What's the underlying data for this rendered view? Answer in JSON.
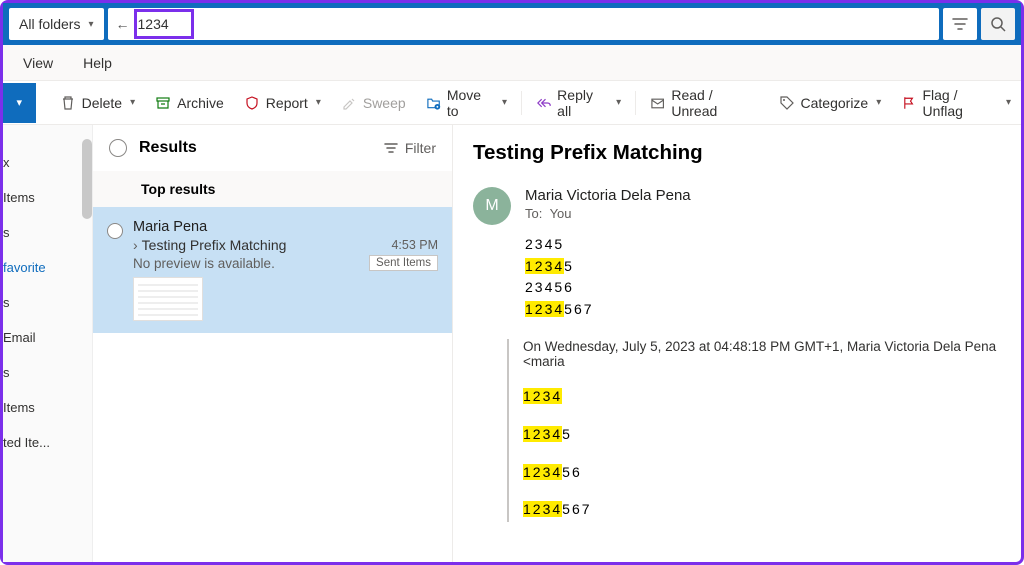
{
  "search": {
    "folder_label": "All folders",
    "query": "1234"
  },
  "menu": {
    "view": "View",
    "help": "Help"
  },
  "toolbar": {
    "delete": "Delete",
    "archive": "Archive",
    "report": "Report",
    "sweep": "Sweep",
    "moveto": "Move to",
    "replyall": "Reply all",
    "readunread": "Read / Unread",
    "categorize": "Categorize",
    "flag": "Flag / Unflag"
  },
  "sidebar": {
    "items": [
      "x",
      "Items",
      "s",
      "favorite",
      "s",
      "Email",
      "s",
      "Items",
      "ted Ite..."
    ]
  },
  "results": {
    "title": "Results",
    "filter": "Filter",
    "top_label": "Top results",
    "item": {
      "from": "Maria Pena",
      "subject": "Testing Prefix Matching",
      "preview": "No preview is available.",
      "time": "4:53 PM",
      "folder": "Sent Items"
    }
  },
  "reading": {
    "subject": "Testing Prefix Matching",
    "avatar_initial": "M",
    "sender": "Maria Victoria Dela Pena",
    "to_label": "To:",
    "to_value": "You",
    "body_lines": [
      {
        "segments": [
          {
            "t": "2345",
            "hl": false
          }
        ]
      },
      {
        "segments": [
          {
            "t": "1234",
            "hl": true
          },
          {
            "t": "5",
            "hl": false
          }
        ]
      },
      {
        "segments": [
          {
            "t": "23456",
            "hl": false
          }
        ]
      },
      {
        "segments": [
          {
            "t": "1234",
            "hl": true
          },
          {
            "t": "567",
            "hl": false
          }
        ]
      }
    ],
    "quoted_header": "On Wednesday, July 5, 2023 at 04:48:18 PM GMT+1, Maria Victoria Dela Pena <maria",
    "quoted_lines": [
      {
        "segments": [
          {
            "t": "1234",
            "hl": true
          }
        ]
      },
      {
        "segments": [
          {
            "t": "1234",
            "hl": true
          },
          {
            "t": "5",
            "hl": false
          }
        ]
      },
      {
        "segments": [
          {
            "t": "1234",
            "hl": true
          },
          {
            "t": "56",
            "hl": false
          }
        ]
      },
      {
        "segments": [
          {
            "t": "1234",
            "hl": true
          },
          {
            "t": "567",
            "hl": false
          }
        ]
      }
    ]
  }
}
